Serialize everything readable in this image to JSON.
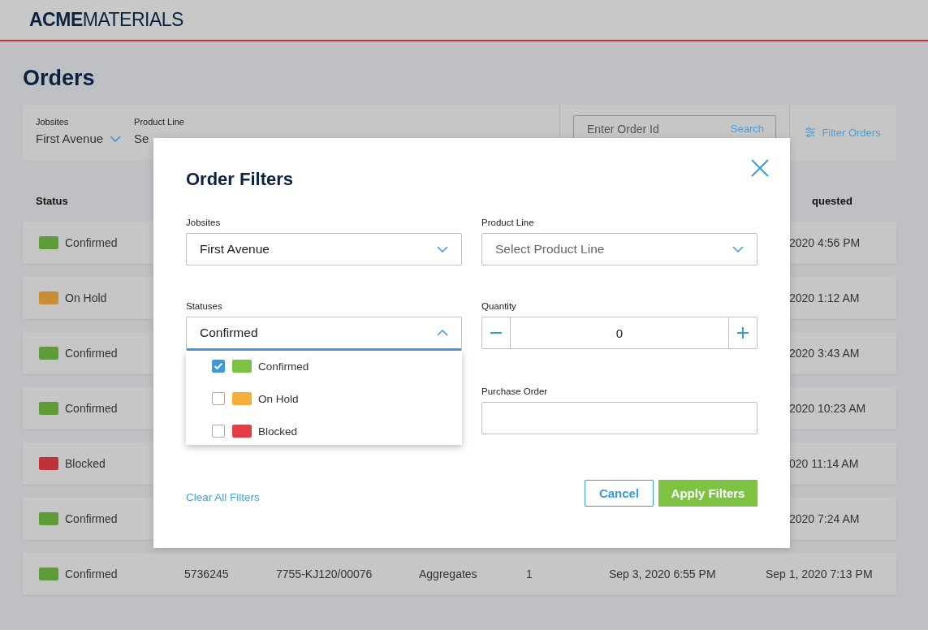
{
  "header": {
    "brand_bold": "ACME",
    "brand_light": "MATERIALS"
  },
  "page_title": "Orders",
  "filter_bar": {
    "jobsites": {
      "label": "Jobsites",
      "value": "First Avenue"
    },
    "product_line": {
      "label": "Product Line",
      "value": "Se"
    },
    "search": {
      "placeholder": "Enter Order Id",
      "button": "Search"
    },
    "filter_button": "Filter Orders"
  },
  "table": {
    "columns": [
      {
        "label": "Status"
      },
      {
        "label": "quested"
      }
    ],
    "rows": [
      {
        "status": "Confirmed",
        "color": "#5e9c37",
        "requested": "2020 4:56 PM"
      },
      {
        "status": "On Hold",
        "color": "#c98e35",
        "requested": "2020 1:12 AM"
      },
      {
        "status": "Confirmed",
        "color": "#5e9c37",
        "requested": "2020 3:43 AM"
      },
      {
        "status": "Confirmed",
        "color": "#5e9c37",
        "requested": "2020 10:23 AM"
      },
      {
        "status": "Blocked",
        "color": "#c0323a",
        "requested": "020 11:14 AM"
      },
      {
        "status": "Confirmed",
        "color": "#5e9c37",
        "requested": "2020 7:24 AM"
      },
      {
        "status": "Confirmed",
        "color": "#5e9c37",
        "cells": [
          "5736245",
          "7755-KJ120/00076",
          "Aggregates",
          "1",
          "Sep 3, 2020 6:55 PM"
        ],
        "requested": "Sep 1, 2020 7:13 PM"
      }
    ]
  },
  "modal": {
    "title": "Order Filters",
    "jobsites": {
      "label": "Jobsites",
      "value": "First Avenue"
    },
    "product_line": {
      "label": "Product Line",
      "placeholder": "Select Product Line"
    },
    "statuses": {
      "label": "Statuses",
      "value": "Confirmed",
      "expanded": true,
      "options": [
        {
          "label": "Confirmed",
          "color": "#7dc242",
          "checked": true
        },
        {
          "label": "On Hold",
          "color": "#f6ae3b",
          "checked": false
        },
        {
          "label": "Blocked",
          "color": "#e63d45",
          "checked": false
        }
      ]
    },
    "quantity": {
      "label": "Quantity",
      "value": "0"
    },
    "purchase_order": {
      "label": "Purchase Order"
    },
    "clear": "Clear All Filters",
    "cancel": "Cancel",
    "apply": "Apply Filters"
  }
}
